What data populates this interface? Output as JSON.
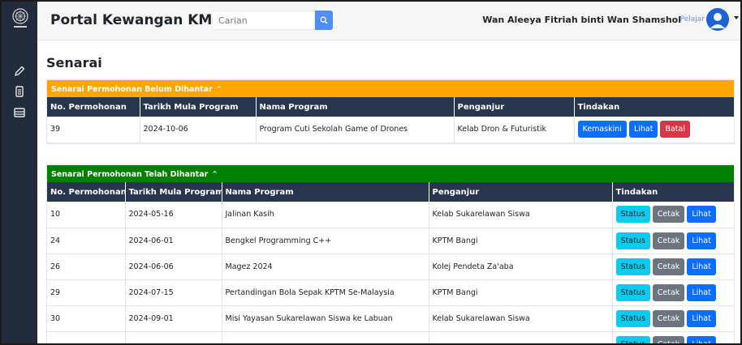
{
  "colors": {
    "sidebar": "#222c3c",
    "table_header": "#27364f",
    "draft_header": "#ffa500",
    "submitted_header": "#008000",
    "primary": "#0d6efd",
    "danger": "#dc3545",
    "info": "#0dcaf0",
    "secondary": "#6c757d"
  },
  "sidebar": {
    "logo_icon": "kmukm-logo-icon",
    "items": [
      {
        "icon": "pencil-icon"
      },
      {
        "icon": "document-icon"
      },
      {
        "icon": "table-icon"
      }
    ]
  },
  "header": {
    "brand": "Portal Kewangan KMUKM",
    "search_placeholder": "Carian",
    "search_icon": "search-icon",
    "user_name": "Wan Aleeya Fitriah binti Wan Shamshol",
    "user_role": "Pelajar"
  },
  "page": {
    "title": "Senarai"
  },
  "draft": {
    "heading": "Senarai Permohonan Belum Dihantar",
    "chevron": "^",
    "columns": [
      "No. Permohonan",
      "Tarikh Mula Program",
      "Nama Program",
      "Penganjur",
      "Tindakan"
    ],
    "rows": [
      {
        "no": "39",
        "date": "2024-10-06",
        "name": "Program Cuti Sekolah Game of Drones",
        "organizer": "Kelab Dron & Futuristik"
      }
    ],
    "actions": {
      "edit": "Kemaskini",
      "view": "Lihat",
      "cancel": "Batal"
    }
  },
  "submitted": {
    "heading": "Senarai Permohonan Telah Dihantar",
    "chevron": "^",
    "columns": [
      "No. Permohonan",
      "Tarikh Mula Program",
      "Nama Program",
      "Penganjur",
      "Tindakan"
    ],
    "rows": [
      {
        "no": "10",
        "date": "2024-05-16",
        "name": "Jalinan Kasih",
        "organizer": "Kelab Sukarelawan Siswa"
      },
      {
        "no": "24",
        "date": "2024-06-01",
        "name": "Bengkel Programming C++",
        "organizer": "KPTM Bangi"
      },
      {
        "no": "26",
        "date": "2024-06-06",
        "name": "Magez 2024",
        "organizer": "Kolej Pendeta Za'aba"
      },
      {
        "no": "29",
        "date": "2024-07-15",
        "name": "Pertandingan Bola Sepak KPTM Se-Malaysia",
        "organizer": "KPTM Bangi"
      },
      {
        "no": "30",
        "date": "2024-09-01",
        "name": "Misi Yayasan Sukarelawan Siswa ke Labuan",
        "organizer": "Kelab Sukarelawan Siswa"
      }
    ],
    "actions": {
      "status": "Status",
      "print": "Cetak",
      "view": "Lihat"
    }
  }
}
